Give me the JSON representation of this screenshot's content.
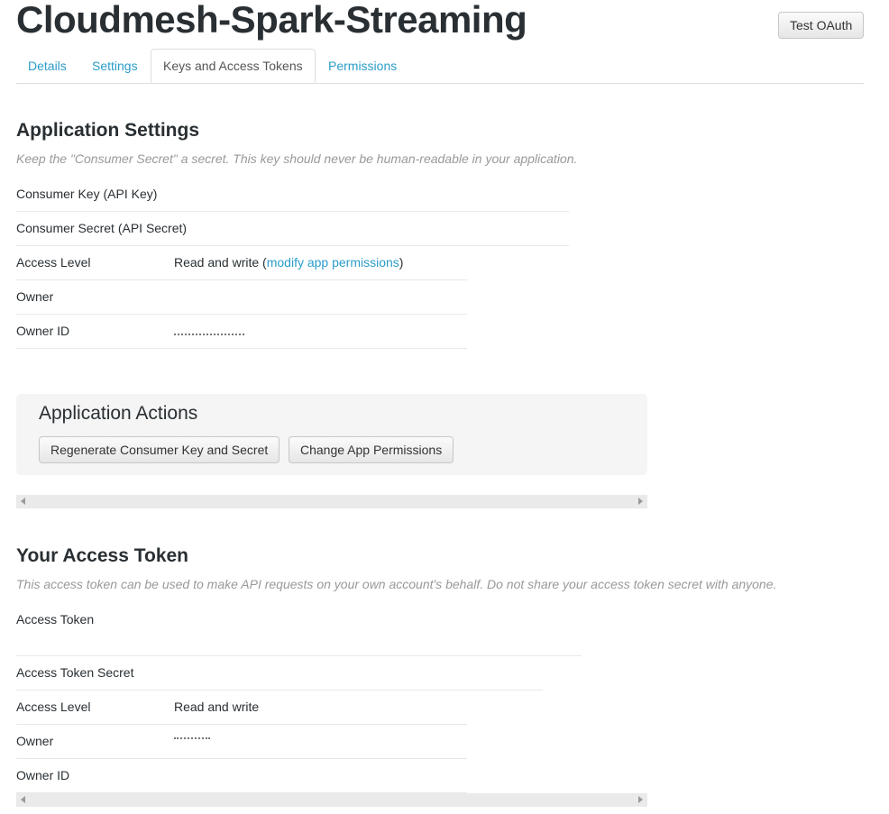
{
  "app": {
    "title": "Cloudmesh-Spark-Streaming",
    "test_oauth_label": "Test OAuth"
  },
  "tabs": [
    {
      "label": "Details",
      "active": false
    },
    {
      "label": "Settings",
      "active": false
    },
    {
      "label": "Keys and Access Tokens",
      "active": true
    },
    {
      "label": "Permissions",
      "active": false
    }
  ],
  "app_settings": {
    "title": "Application Settings",
    "description": "Keep the \"Consumer Secret\" a secret. This key should never be human-readable in your application.",
    "consumer_key_label": "Consumer Key (API Key)",
    "consumer_secret_label": "Consumer Secret (API Secret)",
    "access_level_label": "Access Level",
    "access_level_value": "Read and write (",
    "access_level_link": "modify app permissions",
    "access_level_close": ")",
    "owner_label": "Owner",
    "owner_id_label": "Owner ID"
  },
  "app_actions": {
    "title": "Application Actions",
    "regenerate_label": "Regenerate Consumer Key and Secret",
    "change_permissions_label": "Change App Permissions"
  },
  "access_token": {
    "title": "Your Access Token",
    "description": "This access token can be used to make API requests on your own account's behalf. Do not share your access token secret with anyone.",
    "token_label": "Access Token",
    "token_secret_label": "Access Token Secret",
    "access_level_label": "Access Level",
    "access_level_value": "Read and write",
    "owner_label": "Owner",
    "owner_id_label": "Owner ID"
  },
  "colors": {
    "link": "#2b9dc9",
    "text": "#292f33",
    "muted": "#999999"
  }
}
